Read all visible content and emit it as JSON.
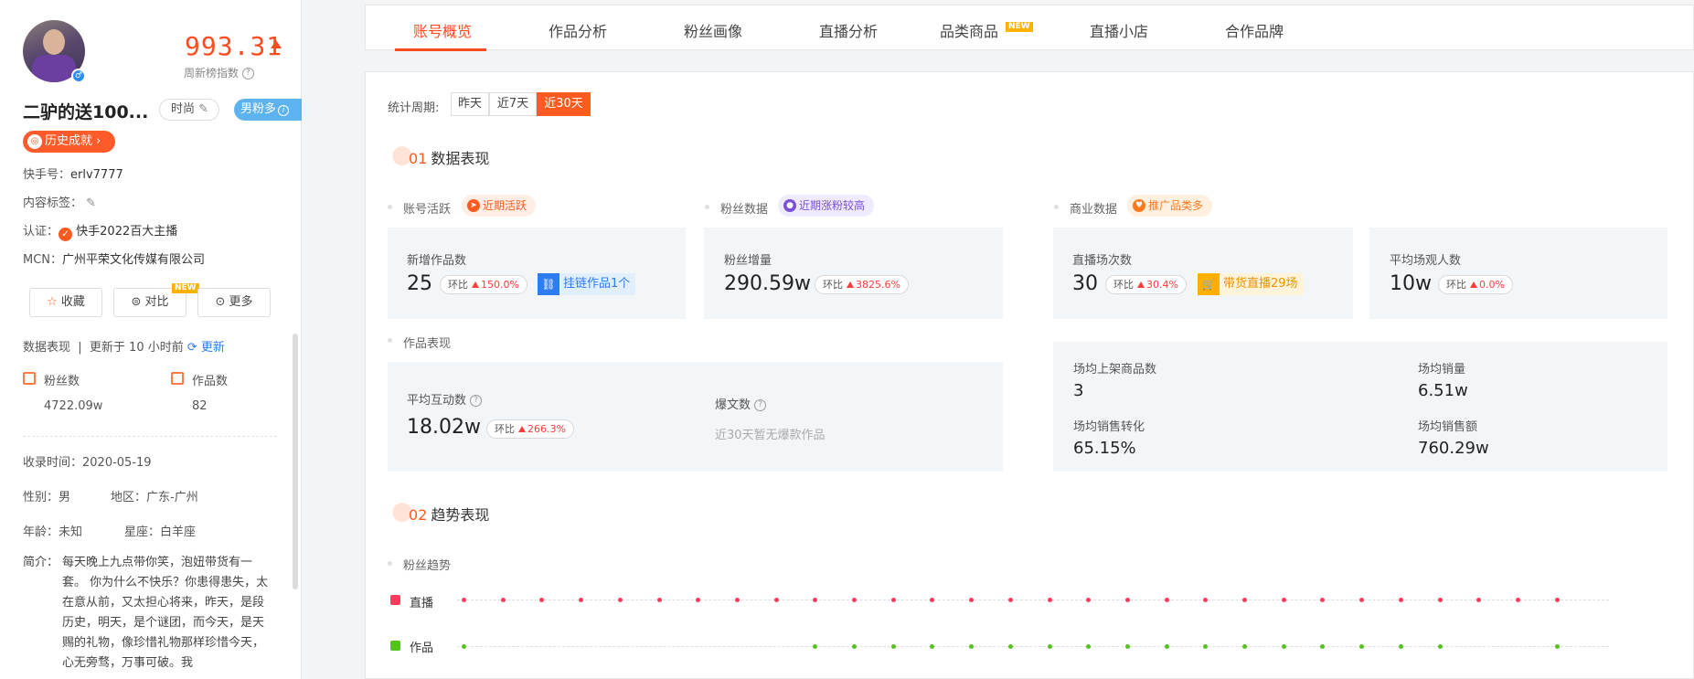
{
  "profile": {
    "score": "993.31",
    "score_label": "周新榜指数",
    "name": "二驴的送100...",
    "tag_fashion": "时尚",
    "tag_male": "男粉多",
    "honor": "历史成就",
    "kuaishou_id_label": "快手号：",
    "kuaishou_id": "erlv7777",
    "content_tag_label": "内容标签：",
    "cert_label": "认证：",
    "cert_value": "快手2022百大主播",
    "mcn_label": "MCN：",
    "mcn_value": "广州平荣文化传媒有限公司",
    "btn_fav": "收藏",
    "btn_compare": "对比",
    "btn_more": "更多",
    "new_badge": "NEW",
    "data_status": "数据表现  |  更新于 10 小时前",
    "refresh": "更新",
    "fans_label": "粉丝数",
    "fans_value": "4722.09w",
    "works_label": "作品数",
    "works_value": "82",
    "collect_time": "收录时间：2020-05-19",
    "gender": "性别：男",
    "region": "地区：广东-广州",
    "age": "年龄：未知",
    "zodiac": "星座：白羊座",
    "bio_label": "简介：",
    "bio": "每天晚上九点带你笑，泡妞带货有一套。 你为什么不快乐？你患得患失，太在意从前，又太担心将来，昨天，是段历史，明天，是个谜团，而今天，是天赐的礼物，像珍惜礼物那样珍惜今天，心无旁骛，万事可破。我"
  },
  "tabs": [
    "账号概览",
    "作品分析",
    "粉丝画像",
    "直播分析",
    "品类商品",
    "直播小店",
    "合作品牌"
  ],
  "tab_new_badge": "NEW",
  "period": {
    "label": "统计周期:",
    "options": [
      "昨天",
      "近7天",
      "近30天"
    ],
    "selected": "近30天"
  },
  "section1": {
    "num": "01",
    "title": "数据表现",
    "account_activity": "账号活跃",
    "account_activity_pill": "近期活跃",
    "new_works_label": "新增作品数",
    "new_works_value": "25",
    "new_works_cmp_label": "环比",
    "new_works_cmp": "150.0%",
    "linked_works": "挂链作品1个",
    "fans_data": "粉丝数据",
    "fans_data_pill": "近期涨粉较高",
    "fans_growth_label": "粉丝增量",
    "fans_growth_value": "290.59w",
    "fans_growth_cmp_label": "环比",
    "fans_growth_cmp": "3825.6%",
    "works_perf": "作品表现",
    "avg_interact_label": "平均互动数",
    "avg_interact_value": "18.02w",
    "avg_interact_cmp_label": "环比",
    "avg_interact_cmp": "266.3%",
    "hits_label": "爆文数",
    "hits_empty": "近30天暂无爆款作品",
    "biz_data": "商业数据",
    "biz_pill": "推广品类多",
    "live_count_label": "直播场次数",
    "live_count_value": "30",
    "live_count_cmp_label": "环比",
    "live_count_cmp": "30.4%",
    "live_goods_chip": "带货直播29场",
    "avg_viewers_label": "平均场观人数",
    "avg_viewers_value": "10w",
    "avg_viewers_cmp_label": "环比",
    "avg_viewers_cmp": "0.0%",
    "avg_listed_label": "场均上架商品数",
    "avg_listed_value": "3",
    "avg_sales_label": "场均销量",
    "avg_sales_value": "6.51w",
    "avg_conv_label": "场均销售转化",
    "avg_conv_value": "65.15%",
    "avg_revenue_label": "场均销售额",
    "avg_revenue_value": "760.29w"
  },
  "section2": {
    "num": "02",
    "title": "趋势表现",
    "fans_trend": "粉丝趋势",
    "live_label": "直播",
    "works_label": "作品"
  },
  "colors": {
    "accent": "#ff4c1f",
    "live_dot": "#ff3b5c",
    "works_dot": "#52c41a",
    "blue": "#2d7cf0"
  },
  "trend": {
    "live_dots": 29,
    "works_dot_positions_note": ""
  }
}
